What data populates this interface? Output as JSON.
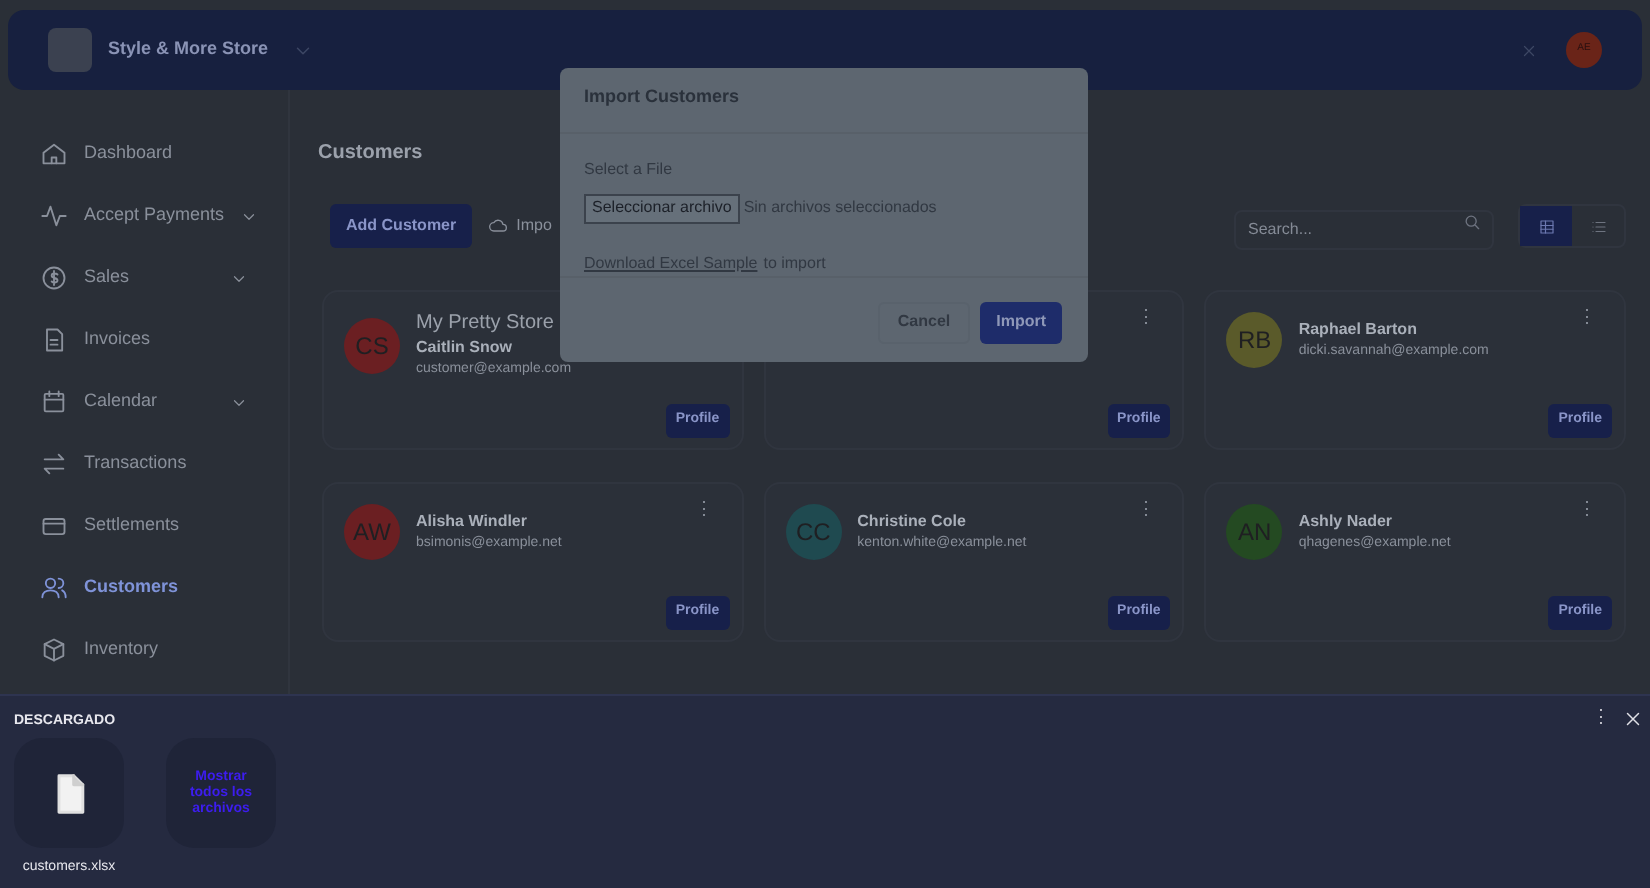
{
  "header": {
    "store_name": "Style & More Store",
    "avatar_initials": "AE"
  },
  "sidebar": {
    "items": [
      {
        "label": "Dashboard",
        "expandable": false,
        "selected": false
      },
      {
        "label": "Accept Payments",
        "expandable": true,
        "selected": false
      },
      {
        "label": "Sales",
        "expandable": true,
        "selected": false
      },
      {
        "label": "Invoices",
        "expandable": false,
        "selected": false
      },
      {
        "label": "Calendar",
        "expandable": true,
        "selected": false
      },
      {
        "label": "Transactions",
        "expandable": false,
        "selected": false
      },
      {
        "label": "Settlements",
        "expandable": false,
        "selected": false
      },
      {
        "label": "Customers",
        "expandable": false,
        "selected": true
      },
      {
        "label": "Inventory",
        "expandable": false,
        "selected": false
      }
    ]
  },
  "page": {
    "title": "Customers",
    "add_button": "Add Customer",
    "import_button": "Impo",
    "search": {
      "placeholder": "Search..."
    },
    "view_toggle": [
      {
        "kind": "grid",
        "selected": true
      },
      {
        "kind": "list",
        "selected": false
      }
    ],
    "cards": [
      {
        "store": "My Pretty Store",
        "name": "Caitlin Snow",
        "email": "customer@example.com",
        "initials": "CS",
        "color": "#6b1f22",
        "profile": "Profile"
      },
      {
        "menu": "⋮",
        "profile": "Profile"
      },
      {
        "name": "Raphael Barton",
        "email": "dicki.savannah@example.com",
        "initials": "RB",
        "color": "#5a5a2a",
        "menu": "⋮",
        "profile": "Profile"
      },
      {
        "name": "Alisha Windler",
        "email": "bsimonis@example.net",
        "initials": "AW",
        "color": "#6b1f22",
        "menu": "⋮",
        "profile": "Profile"
      },
      {
        "name": "Christine Cole",
        "email": "kenton.white@example.net",
        "initials": "CC",
        "color": "#1f4a50",
        "menu": "⋮",
        "profile": "Profile"
      },
      {
        "name": "Ashly Nader",
        "email": "qhagenes@example.net",
        "initials": "AN",
        "color": "#244a22",
        "menu": "⋮",
        "profile": "Profile"
      }
    ]
  },
  "modal": {
    "title": "Import Customers",
    "field_label": "Select a File",
    "file_button": "Seleccionar archivo",
    "file_status": "Sin archivos seleccionados",
    "link": "Download Excel Sample",
    "link_suffix": "to import",
    "cancel": "Cancel",
    "submit": "Import"
  },
  "downloads": {
    "title": "DESCARGADO",
    "menu": "⋮",
    "file": "customers.xlsx",
    "show_all": "Mostrar todos los archivos"
  }
}
